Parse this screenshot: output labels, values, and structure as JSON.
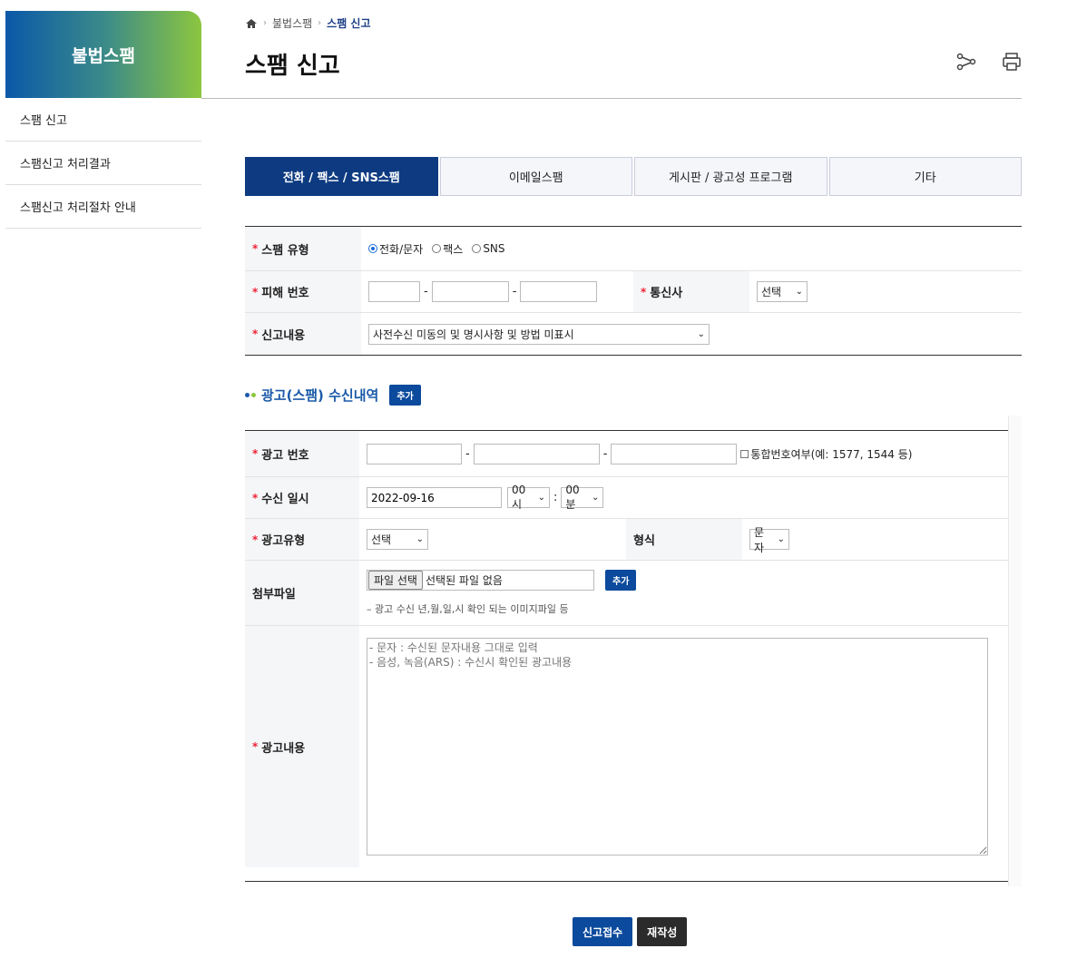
{
  "sidebar": {
    "title": "불법스팸",
    "items": [
      {
        "label": "스팸 신고"
      },
      {
        "label": "스팸신고 처리결과"
      },
      {
        "label": "스팸신고 처리절차 안내"
      }
    ]
  },
  "breadcrumb": {
    "level1": "불법스팸",
    "current": "스팸 신고"
  },
  "page_title": "스팸 신고",
  "tabs": [
    {
      "label": "전화 / 팩스 / SNS스팸",
      "active": true
    },
    {
      "label": "이메일스팸"
    },
    {
      "label": "게시판 / 광고성 프로그램"
    },
    {
      "label": "기타"
    }
  ],
  "form1": {
    "req_mark": "*",
    "spam_type_label": "스팸 유형",
    "spam_type_options": [
      "전화/문자",
      "팩스",
      "SNS"
    ],
    "victim_number_label": "피해 번호",
    "dash": "-",
    "carrier_label": "통신사",
    "carrier_value": "선택",
    "content_label": "신고내용",
    "content_value": "사전수신 미동의 및 명시사항 및 방법 미표시"
  },
  "section": {
    "title": "광고(스팸) 수신내역",
    "add_label": "추가"
  },
  "form2": {
    "ad_number_label": "광고 번호",
    "combined_number_label": "통합번호여부(예: 1577, 1544 등)",
    "recv_date_label": "수신 일시",
    "recv_date_value": "2022-09-16",
    "hour_value": "00시",
    "colon": ":",
    "minute_value": "00분",
    "ad_type_label": "광고유형",
    "ad_type_value": "선택",
    "format_label": "형식",
    "format_value": "문자",
    "attach_label": "첨부파일",
    "file_button": "파일 선택",
    "file_status": "선택된 파일 없음",
    "attach_add": "추가",
    "attach_hint": "–  광고 수신 년,월,일,시 확인 되는 이미지파일 등",
    "ad_content_label": "광고내용",
    "ad_content_placeholder": "- 문자 : 수신된 문자내용 그대로 입력\n- 음성, 녹음(ARS) : 수신시 확인된 광고내용"
  },
  "buttons": {
    "submit": "신고접수",
    "reset": "재작성"
  }
}
